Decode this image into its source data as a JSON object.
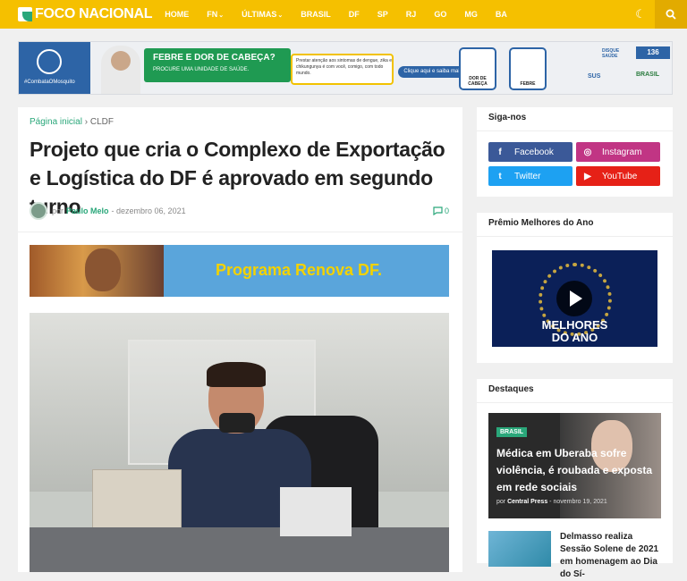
{
  "header": {
    "logo": "FOCO NACIONAL",
    "nav": [
      "HOME",
      "FN",
      "ÚLTIMAS",
      "BRASIL",
      "DF",
      "SP",
      "RJ",
      "GO",
      "MG",
      "BA"
    ],
    "nav_dropdown": [
      false,
      true,
      true,
      false,
      false,
      false,
      false,
      false,
      false,
      false
    ]
  },
  "banner_ad": {
    "tag": "#CombataOMosquito",
    "headline": "FEBRE E DOR DE CABEÇA?",
    "subline": "PROCURE UMA UNIDADE DE SAÚDE.",
    "notice": "Prestar atenção aos sintomas de dengue, zika e chikungunya é com você, comigo, com todo mundo.",
    "cta": "Clique aqui e saiba mais",
    "card1": "DOR DE CABEÇA",
    "card2": "FEBRE",
    "disque_label": "DISQUE SAÚDE",
    "disque": "136",
    "sus": "SUS",
    "brasil": "BRASIL"
  },
  "article": {
    "breadcrumb_home": "Página inicial",
    "breadcrumb_sep": "›",
    "breadcrumb_section": "CLDF",
    "title": "Projeto que cria o Complexo de Exportação e Logística do DF é aprovado em segundo turno",
    "by": "por",
    "author": "Paulo Melo",
    "date": "- dezembro 06, 2021",
    "comments": "0",
    "ad_text": "Programa Renova DF."
  },
  "sidebar": {
    "follow_title": "Siga-nos",
    "social": [
      {
        "label": "Facebook",
        "icon": "f",
        "color": "#3b5998"
      },
      {
        "label": "Instagram",
        "icon": "◎",
        "color": "#c13584"
      },
      {
        "label": "Twitter",
        "icon": "t",
        "color": "#1da1f2"
      },
      {
        "label": "YouTube",
        "icon": "▶",
        "color": "#e62117"
      }
    ],
    "award_title": "Prêmio Melhores do Ano",
    "video_line1": "MELHORES",
    "video_line2": "DO ANO",
    "featured_title": "Destaques",
    "featured": {
      "badge": "BRASIL",
      "title": "Médica em Uberaba sofre violência, é roubada e exposta em rede sociais",
      "by": "por",
      "author": "Central Press",
      "date": "- novembro 19, 2021"
    },
    "item2_title": "Delmasso realiza Sessão Solene de 2021 em homenagem ao Dia do Sí-"
  }
}
